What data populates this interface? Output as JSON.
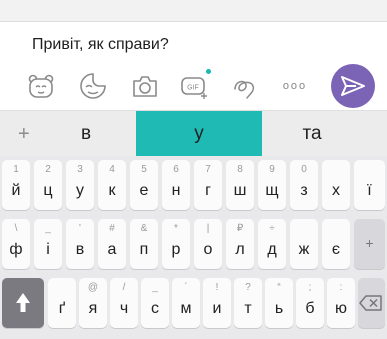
{
  "compose": {
    "message_text": "Привіт, як справи?",
    "toolbar_icons": [
      "sticker-icon",
      "emoji-sticker-icon",
      "camera-icon",
      "gif-icon",
      "doodle-icon",
      "more-icon"
    ],
    "gif_label": "GIF",
    "more_label": "ooo",
    "accent_color": "#7b63b5",
    "dot_color": "#17b8b3"
  },
  "suggestions": {
    "plus": "+",
    "words": [
      "в",
      "у",
      "та"
    ],
    "active_index": 1,
    "active_color": "#1fbab4"
  },
  "keyboard": {
    "row1": {
      "keys": [
        "й",
        "ц",
        "у",
        "к",
        "е",
        "н",
        "г",
        "ш",
        "щ",
        "з",
        "х",
        "ї"
      ],
      "hints": [
        "1",
        "2",
        "3",
        "4",
        "5",
        "6",
        "7",
        "8",
        "9",
        "0",
        "",
        ""
      ]
    },
    "row2": {
      "keys": [
        "ф",
        "і",
        "в",
        "а",
        "п",
        "р",
        "о",
        "л",
        "д",
        "ж",
        "є"
      ],
      "hints": [
        "\\",
        "_",
        "'",
        "#",
        "&",
        "*",
        "|",
        "₽",
        "÷",
        "",
        ""
      ],
      "side_label": "+"
    },
    "row3": {
      "keys": [
        "ґ",
        "я",
        "ч",
        "с",
        "м",
        "и",
        "т",
        "ь",
        "б",
        "ю"
      ],
      "hints": [
        "",
        "@",
        "/",
        "_",
        "´",
        "!",
        "?",
        "“",
        ";",
        ":"
      ]
    }
  }
}
